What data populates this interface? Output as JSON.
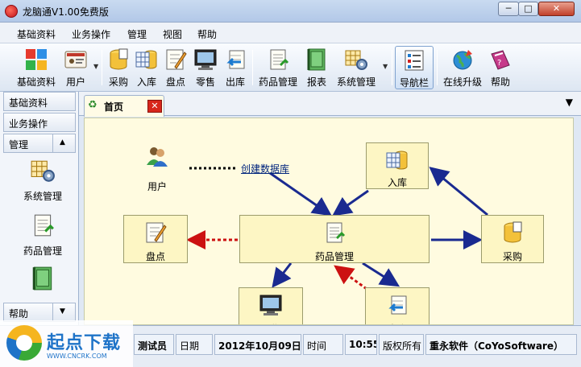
{
  "window": {
    "title": "龙脑通V1.00免费版",
    "min_label": "─",
    "max_label": "□",
    "close_label": "✕"
  },
  "menu": [
    "基础资料",
    "业务操作",
    "管理",
    "视图",
    "帮助"
  ],
  "toolbar": {
    "items": [
      "基础资料",
      "用户",
      "采购",
      "入库",
      "盘点",
      "零售",
      "出库",
      "药品管理",
      "报表",
      "系统管理",
      "导航栏",
      "在线升级",
      "帮助"
    ]
  },
  "sidebar": {
    "headers": [
      "基础资料",
      "业务操作",
      "管理",
      "帮助"
    ],
    "scroll_up": "▲",
    "scroll_down": "▼",
    "entries": [
      "系统管理",
      "药品管理",
      "报表"
    ]
  },
  "tab": {
    "label": "首页",
    "close": "✕",
    "menu": "▼"
  },
  "flow": {
    "user": "用户",
    "create_db": "创建数据库",
    "inbound": "入库",
    "inventory": "盘点",
    "drug_mgmt": "药品管理",
    "purchase": "采购",
    "retail": "零售",
    "outbound": "出库"
  },
  "status": {
    "user": "测试员",
    "date_label": "日期",
    "date": "2012年10月09日",
    "time_label": "时间",
    "time": "10:55",
    "copyright": "版权所有",
    "company": "重永软件（CoYoSoftware）"
  },
  "watermark": {
    "name": "起点下载",
    "url": "WWW.CNCRK.COM"
  },
  "colors": {
    "arrow": "#1a2a90",
    "dashed_arrow": "#cc1111",
    "node_fill": "#fdf6c4",
    "canvas": "#fffbe0"
  }
}
